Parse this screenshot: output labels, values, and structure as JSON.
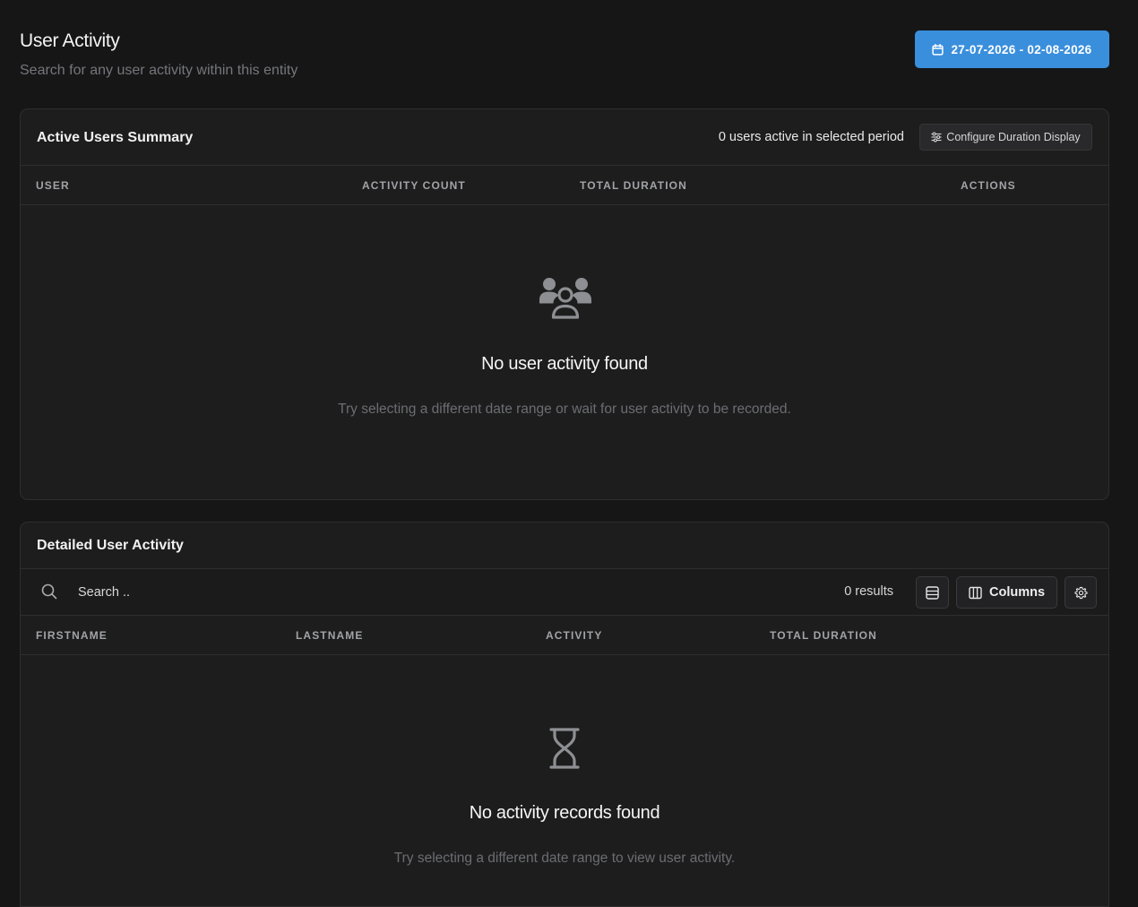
{
  "page": {
    "title": "User Activity",
    "subtitle": "Search for any user activity within this entity"
  },
  "date_range": {
    "label": "27-07-2026 - 02-08-2026",
    "icon": "calendar-icon",
    "color": "#3a8fdc"
  },
  "summary": {
    "title": "Active Users Summary",
    "active_count_text": "0 users active in selected period",
    "configure_label": "Configure Duration Display",
    "columns": [
      "USER",
      "ACTIVITY COUNT",
      "TOTAL DURATION",
      "ACTIONS"
    ],
    "empty_icon": "users-group-icon",
    "empty_title": "No user activity found",
    "empty_desc": "Try selecting a different date range or wait for user activity to be recorded."
  },
  "detailed": {
    "title": "Detailed User Activity",
    "search_placeholder": "Search ..",
    "search_value": "",
    "results_text": "0 results",
    "columns_label": "Columns",
    "columns": [
      "FIRSTNAME",
      "LASTNAME",
      "ACTIVITY",
      "TOTAL DURATION"
    ],
    "empty_icon": "hourglass-icon",
    "empty_title": "No activity records found",
    "empty_desc": "Try selecting a different date range to view user activity."
  }
}
